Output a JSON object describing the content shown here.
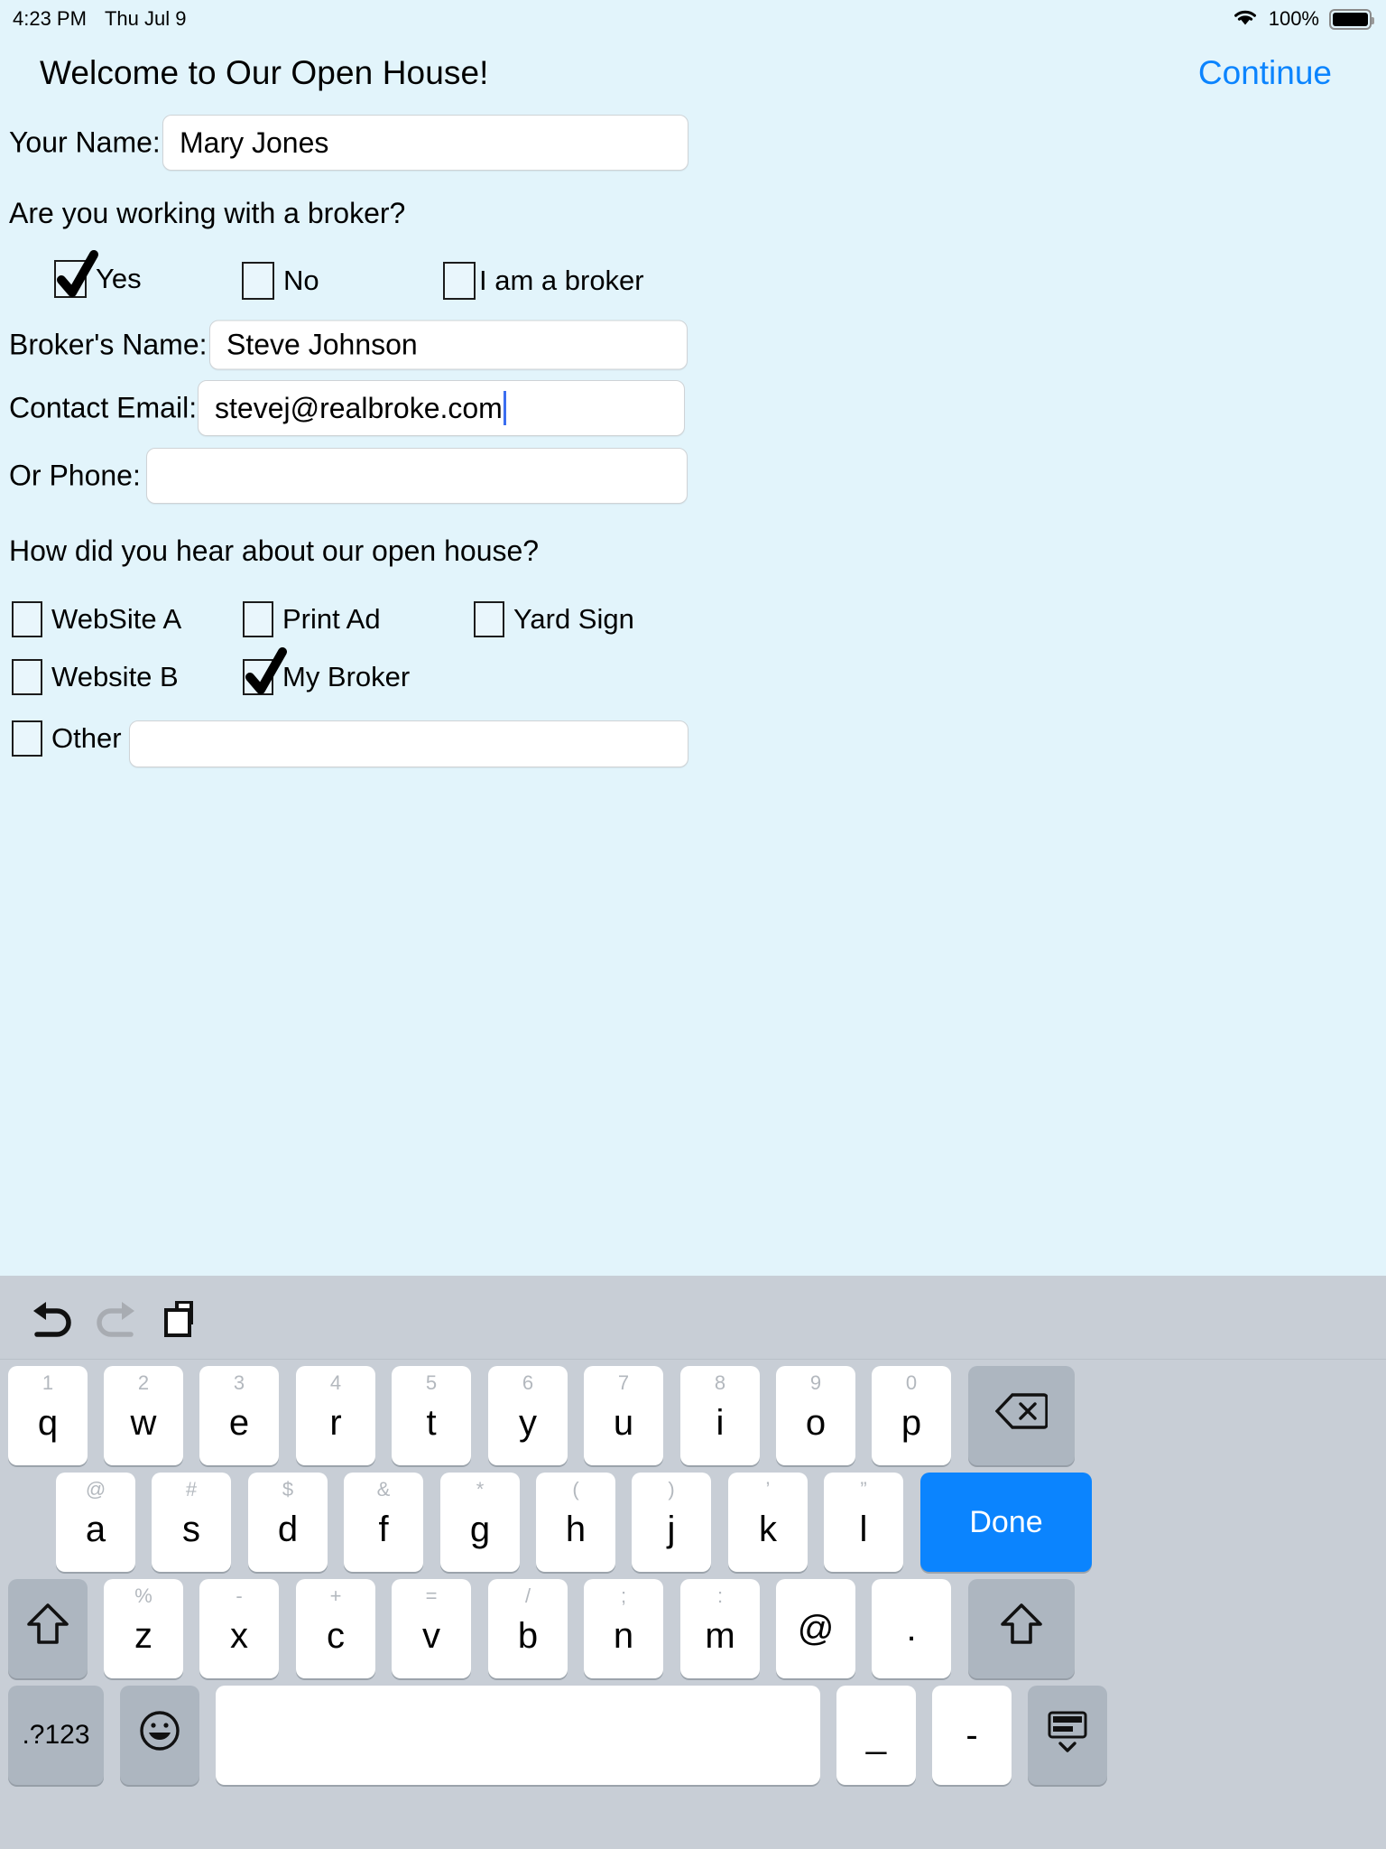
{
  "statusbar": {
    "time": "4:23 PM",
    "date": "Thu Jul 9",
    "wifi_icon": "wifi-icon",
    "battery_percent": "100%",
    "battery_icon": "battery-full-icon"
  },
  "header": {
    "title": "Welcome to Our Open House!",
    "continue_label": "Continue"
  },
  "form": {
    "name_label": "Your Name:",
    "name_value": "Mary Jones",
    "name_placeholder": "",
    "broker_question": "Are you working with a broker?",
    "broker_options": [
      {
        "label": "Yes",
        "checked": true
      },
      {
        "label": "No",
        "checked": false
      },
      {
        "label": "I am a broker",
        "checked": false
      }
    ],
    "broker_name_label": "Broker's Name:",
    "broker_name_value": "Steve Johnson",
    "contact_email_label": "Contact Email:",
    "contact_email_value": "stevej@realbroke.com",
    "phone_label": "Or Phone:",
    "phone_value": "",
    "hear_question": "How did you hear about our open house?",
    "hear_options": [
      {
        "label": "WebSite A",
        "checked": false
      },
      {
        "label": "Print Ad",
        "checked": false
      },
      {
        "label": "Yard Sign",
        "checked": false
      },
      {
        "label": "Website B",
        "checked": false
      },
      {
        "label": "My Broker",
        "checked": true
      },
      {
        "label": "Other",
        "checked": false
      }
    ],
    "other_value": ""
  },
  "keyboard": {
    "toolbar": [
      {
        "name": "undo-icon",
        "enabled": true
      },
      {
        "name": "redo-icon",
        "enabled": false
      },
      {
        "name": "paste-icon",
        "enabled": true
      }
    ],
    "row1": [
      {
        "main": "q",
        "alt": "1"
      },
      {
        "main": "w",
        "alt": "2"
      },
      {
        "main": "e",
        "alt": "3"
      },
      {
        "main": "r",
        "alt": "4"
      },
      {
        "main": "t",
        "alt": "5"
      },
      {
        "main": "y",
        "alt": "6"
      },
      {
        "main": "u",
        "alt": "7"
      },
      {
        "main": "i",
        "alt": "8"
      },
      {
        "main": "o",
        "alt": "9"
      },
      {
        "main": "p",
        "alt": "0"
      }
    ],
    "backspace_icon": "backspace-icon",
    "row2": [
      {
        "main": "a",
        "alt": "@"
      },
      {
        "main": "s",
        "alt": "#"
      },
      {
        "main": "d",
        "alt": "$"
      },
      {
        "main": "f",
        "alt": "&"
      },
      {
        "main": "g",
        "alt": "*"
      },
      {
        "main": "h",
        "alt": "("
      },
      {
        "main": "j",
        "alt": ")"
      },
      {
        "main": "k",
        "alt": "’"
      },
      {
        "main": "l",
        "alt": "”"
      }
    ],
    "done_label": "Done",
    "row3": [
      {
        "main": "z",
        "alt": "%"
      },
      {
        "main": "x",
        "alt": "-"
      },
      {
        "main": "c",
        "alt": "+"
      },
      {
        "main": "v",
        "alt": "="
      },
      {
        "main": "b",
        "alt": "/"
      },
      {
        "main": "n",
        "alt": ";"
      },
      {
        "main": "m",
        "alt": ":"
      },
      {
        "main": "@",
        "alt": ""
      },
      {
        "main": ".",
        "alt": ""
      }
    ],
    "shift_left_icon": "shift-icon",
    "shift_right_icon": "shift-icon",
    "numeric_label": ".?123",
    "emoji_icon": "emoji-icon",
    "space_label": "",
    "underscore_label": "_",
    "hyphen_label": "-",
    "dismiss_icon": "keyboard-dismiss-icon"
  },
  "colors": {
    "page_background": "#e2f4fb",
    "accent_blue": "#0b84fe",
    "caret_blue": "#3b6ef0",
    "keyboard_background": "#c8ced6",
    "key_white": "#ffffff",
    "key_gray": "#adb6c0"
  }
}
